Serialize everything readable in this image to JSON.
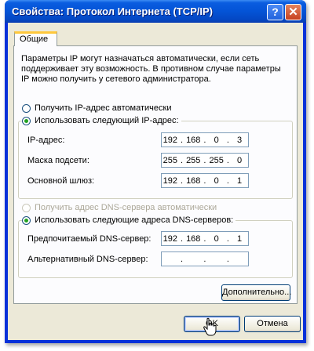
{
  "window": {
    "title": "Свойства: Протокол Интернета (TCP/IP)",
    "help_label": "?",
    "close_label": "✕"
  },
  "tabs": [
    {
      "label": "Общие"
    }
  ],
  "description": "Параметры IP могут назначаться автоматически, если сеть поддерживает эту возможность. В противном случае параметры IP можно получить у сетевого администратора.",
  "ip_mode": {
    "auto_label": "Получить IP-адрес автоматически",
    "manual_label": "Использовать следующий IP-адрес:",
    "selected": "manual"
  },
  "ip_fields": [
    {
      "label": "IP-адрес:",
      "octets": [
        "192",
        "168",
        "0",
        "3"
      ]
    },
    {
      "label": "Маска подсети:",
      "octets": [
        "255",
        "255",
        "255",
        "0"
      ]
    },
    {
      "label": "Основной шлюз:",
      "octets": [
        "192",
        "168",
        "0",
        "1"
      ]
    }
  ],
  "dns_mode": {
    "auto_label": "Получить адрес DNS-сервера автоматически",
    "manual_label": "Использовать следующие адреса DNS-серверов:",
    "selected": "manual"
  },
  "dns_fields": [
    {
      "label": "Предпочитаемый DNS-сервер:",
      "octets": [
        "192",
        "168",
        "0",
        "1"
      ]
    },
    {
      "label": "Альтернативный DNS-сервер:",
      "octets": [
        "",
        "",
        "",
        ""
      ]
    }
  ],
  "buttons": {
    "advanced": "Дополнительно...",
    "ok": "OK",
    "cancel": "Отмена"
  },
  "colors": {
    "titlebar": "#0453d6",
    "dialog_bg": "#ece9d8",
    "radio_dot": "#21a121"
  }
}
